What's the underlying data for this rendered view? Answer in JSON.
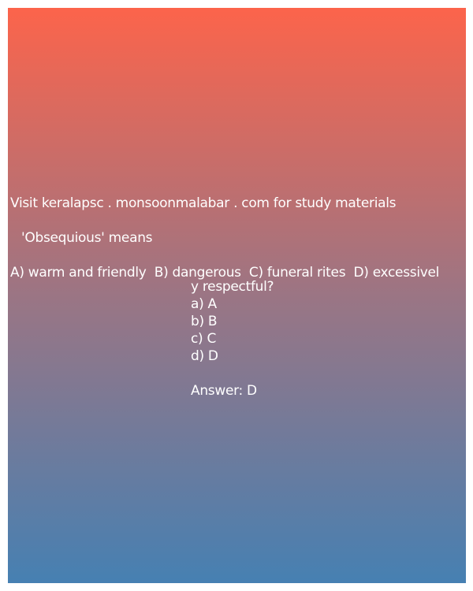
{
  "quiz": {
    "site_line": "Visit keralapsc . monsoonmalabar . com for study materials",
    "question": "'Obsequious' means",
    "options_line": "A) warm and friendly  B) dangerous  C) funeral rites  D) excessivel",
    "options_wrap": "y respectful?",
    "choices": [
      "a) A",
      "b) B",
      "c) C",
      "d) D"
    ],
    "answer": "Answer: D"
  },
  "colors": {
    "gradient_top": "#fc644b",
    "gradient_mid": "#9b7584",
    "gradient_bottom": "#4680b2",
    "text": "#ffffff"
  }
}
